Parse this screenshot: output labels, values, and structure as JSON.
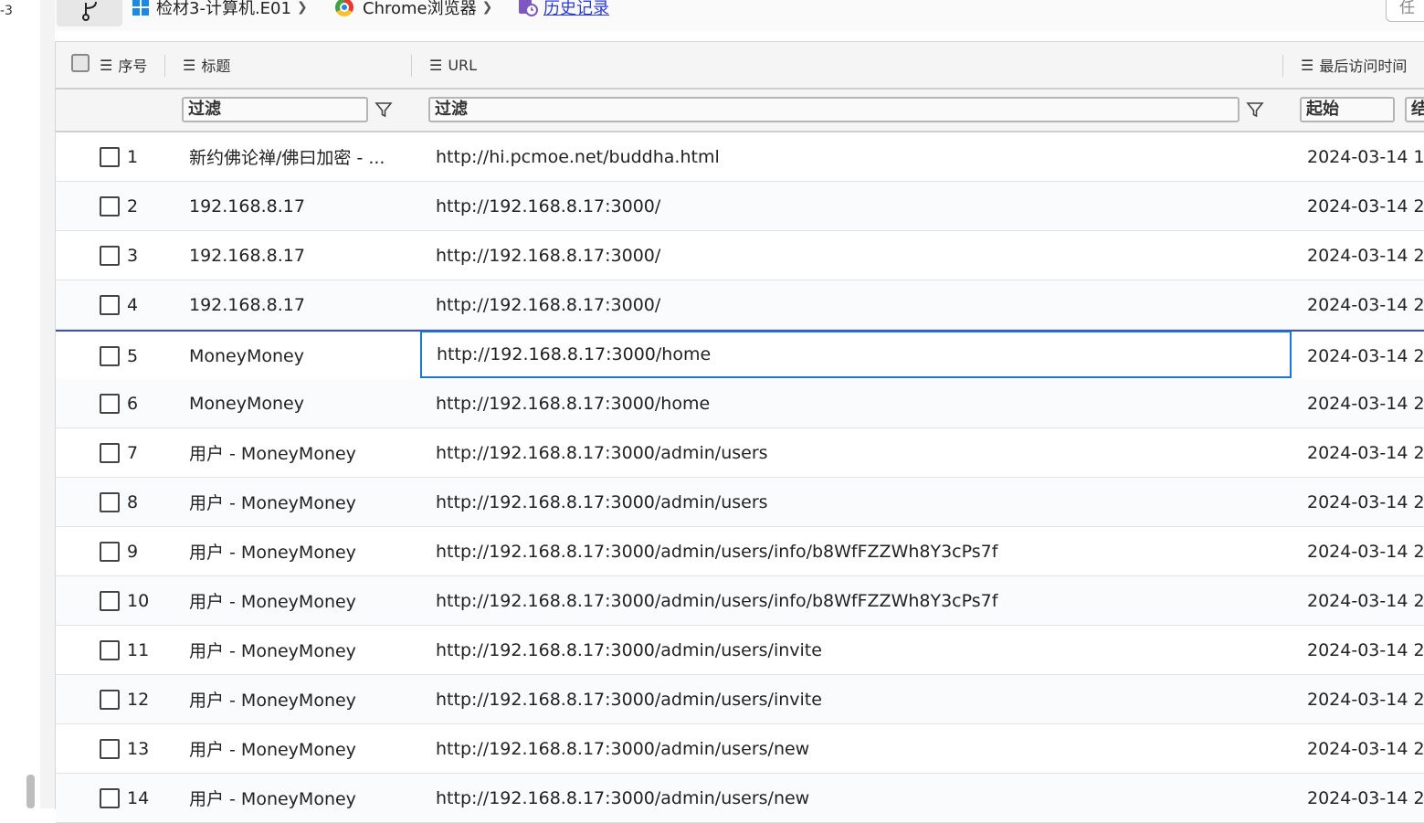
{
  "gutter_label": "-3",
  "breadcrumb": [
    {
      "icon": "windows-icon",
      "label": "检材3-计算机.E01"
    },
    {
      "icon": "chrome-icon",
      "label": "Chrome浏览器"
    },
    {
      "icon": "history-icon",
      "label": "历史记录"
    }
  ],
  "right_button_label": "任",
  "columns": {
    "index": "序号",
    "title": "标题",
    "url": "URL",
    "last_visit": "最后访问时间"
  },
  "filters": {
    "title_placeholder": "过滤",
    "url_placeholder": "过滤",
    "start_label": "起始",
    "end_label": "结"
  },
  "rows": [
    {
      "index": "1",
      "title": "新约佛论禅/佛曰加密 - ...",
      "url": "http://hi.pcmoe.net/buddha.html",
      "time": "2024-03-14 1"
    },
    {
      "index": "2",
      "title": "192.168.8.17",
      "url": "http://192.168.8.17:3000/",
      "time": "2024-03-14 2"
    },
    {
      "index": "3",
      "title": "192.168.8.17",
      "url": "http://192.168.8.17:3000/",
      "time": "2024-03-14 2"
    },
    {
      "index": "4",
      "title": "192.168.8.17",
      "url": "http://192.168.8.17:3000/",
      "time": "2024-03-14 2"
    },
    {
      "index": "5",
      "title": "MoneyMoney",
      "url": "http://192.168.8.17:3000/home",
      "time": "2024-03-14 2"
    },
    {
      "index": "6",
      "title": "MoneyMoney",
      "url": "http://192.168.8.17:3000/home",
      "time": "2024-03-14 2"
    },
    {
      "index": "7",
      "title": "用户 - MoneyMoney",
      "url": "http://192.168.8.17:3000/admin/users",
      "time": "2024-03-14 2"
    },
    {
      "index": "8",
      "title": "用户 - MoneyMoney",
      "url": "http://192.168.8.17:3000/admin/users",
      "time": "2024-03-14 2"
    },
    {
      "index": "9",
      "title": "用户 - MoneyMoney",
      "url": "http://192.168.8.17:3000/admin/users/info/b8WfFZZWh8Y3cPs7f",
      "time": "2024-03-14 2"
    },
    {
      "index": "10",
      "title": "用户 - MoneyMoney",
      "url": "http://192.168.8.17:3000/admin/users/info/b8WfFZZWh8Y3cPs7f",
      "time": "2024-03-14 2"
    },
    {
      "index": "11",
      "title": "用户 - MoneyMoney",
      "url": "http://192.168.8.17:3000/admin/users/invite",
      "time": "2024-03-14 2"
    },
    {
      "index": "12",
      "title": "用户 - MoneyMoney",
      "url": "http://192.168.8.17:3000/admin/users/invite",
      "time": "2024-03-14 2"
    },
    {
      "index": "13",
      "title": "用户 - MoneyMoney",
      "url": "http://192.168.8.17:3000/admin/users/new",
      "time": "2024-03-14 2"
    },
    {
      "index": "14",
      "title": "用户 - MoneyMoney",
      "url": "http://192.168.8.17:3000/admin/users/new",
      "time": "2024-03-14 2"
    }
  ],
  "selected_row_index": "5",
  "colors": {
    "selection_border": "#3f51b5",
    "focus_cell_border": "#1976d2",
    "link": "#2c3bd8"
  }
}
